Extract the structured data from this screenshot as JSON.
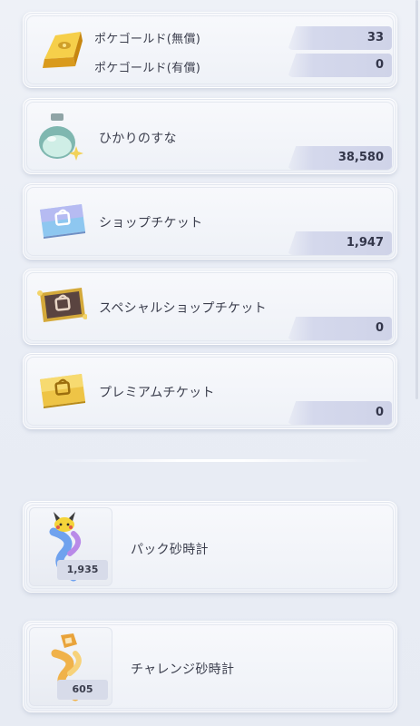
{
  "items": [
    {
      "name": "pokegold",
      "labels": [
        "ポケゴールド(無償)",
        "ポケゴールド(有償)"
      ],
      "values": [
        "33",
        "0"
      ],
      "icon": "gold-bar-icon"
    },
    {
      "name": "stardust",
      "label": "ひかりのすな",
      "value": "38,580",
      "icon": "stardust-bottle-icon"
    },
    {
      "name": "shop-ticket",
      "label": "ショップチケット",
      "value": "1,947",
      "icon": "shop-ticket-icon"
    },
    {
      "name": "special-shop-ticket",
      "label": "スペシャルショップチケット",
      "value": "0",
      "icon": "special-shop-ticket-icon"
    },
    {
      "name": "premium-ticket",
      "label": "プレミアムチケット",
      "value": "0",
      "icon": "premium-ticket-icon"
    }
  ],
  "hourglasses": [
    {
      "name": "pack-hourglass",
      "label": "パック砂時計",
      "count": "1,935",
      "icon": "pack-hourglass-icon"
    },
    {
      "name": "challenge-hourglass",
      "label": "チャレンジ砂時計",
      "count": "605",
      "icon": "challenge-hourglass-icon"
    }
  ],
  "colors": {
    "gold": "#e9b52a",
    "value_bar": "#d2d6ea",
    "text": "#3b3e4d"
  }
}
